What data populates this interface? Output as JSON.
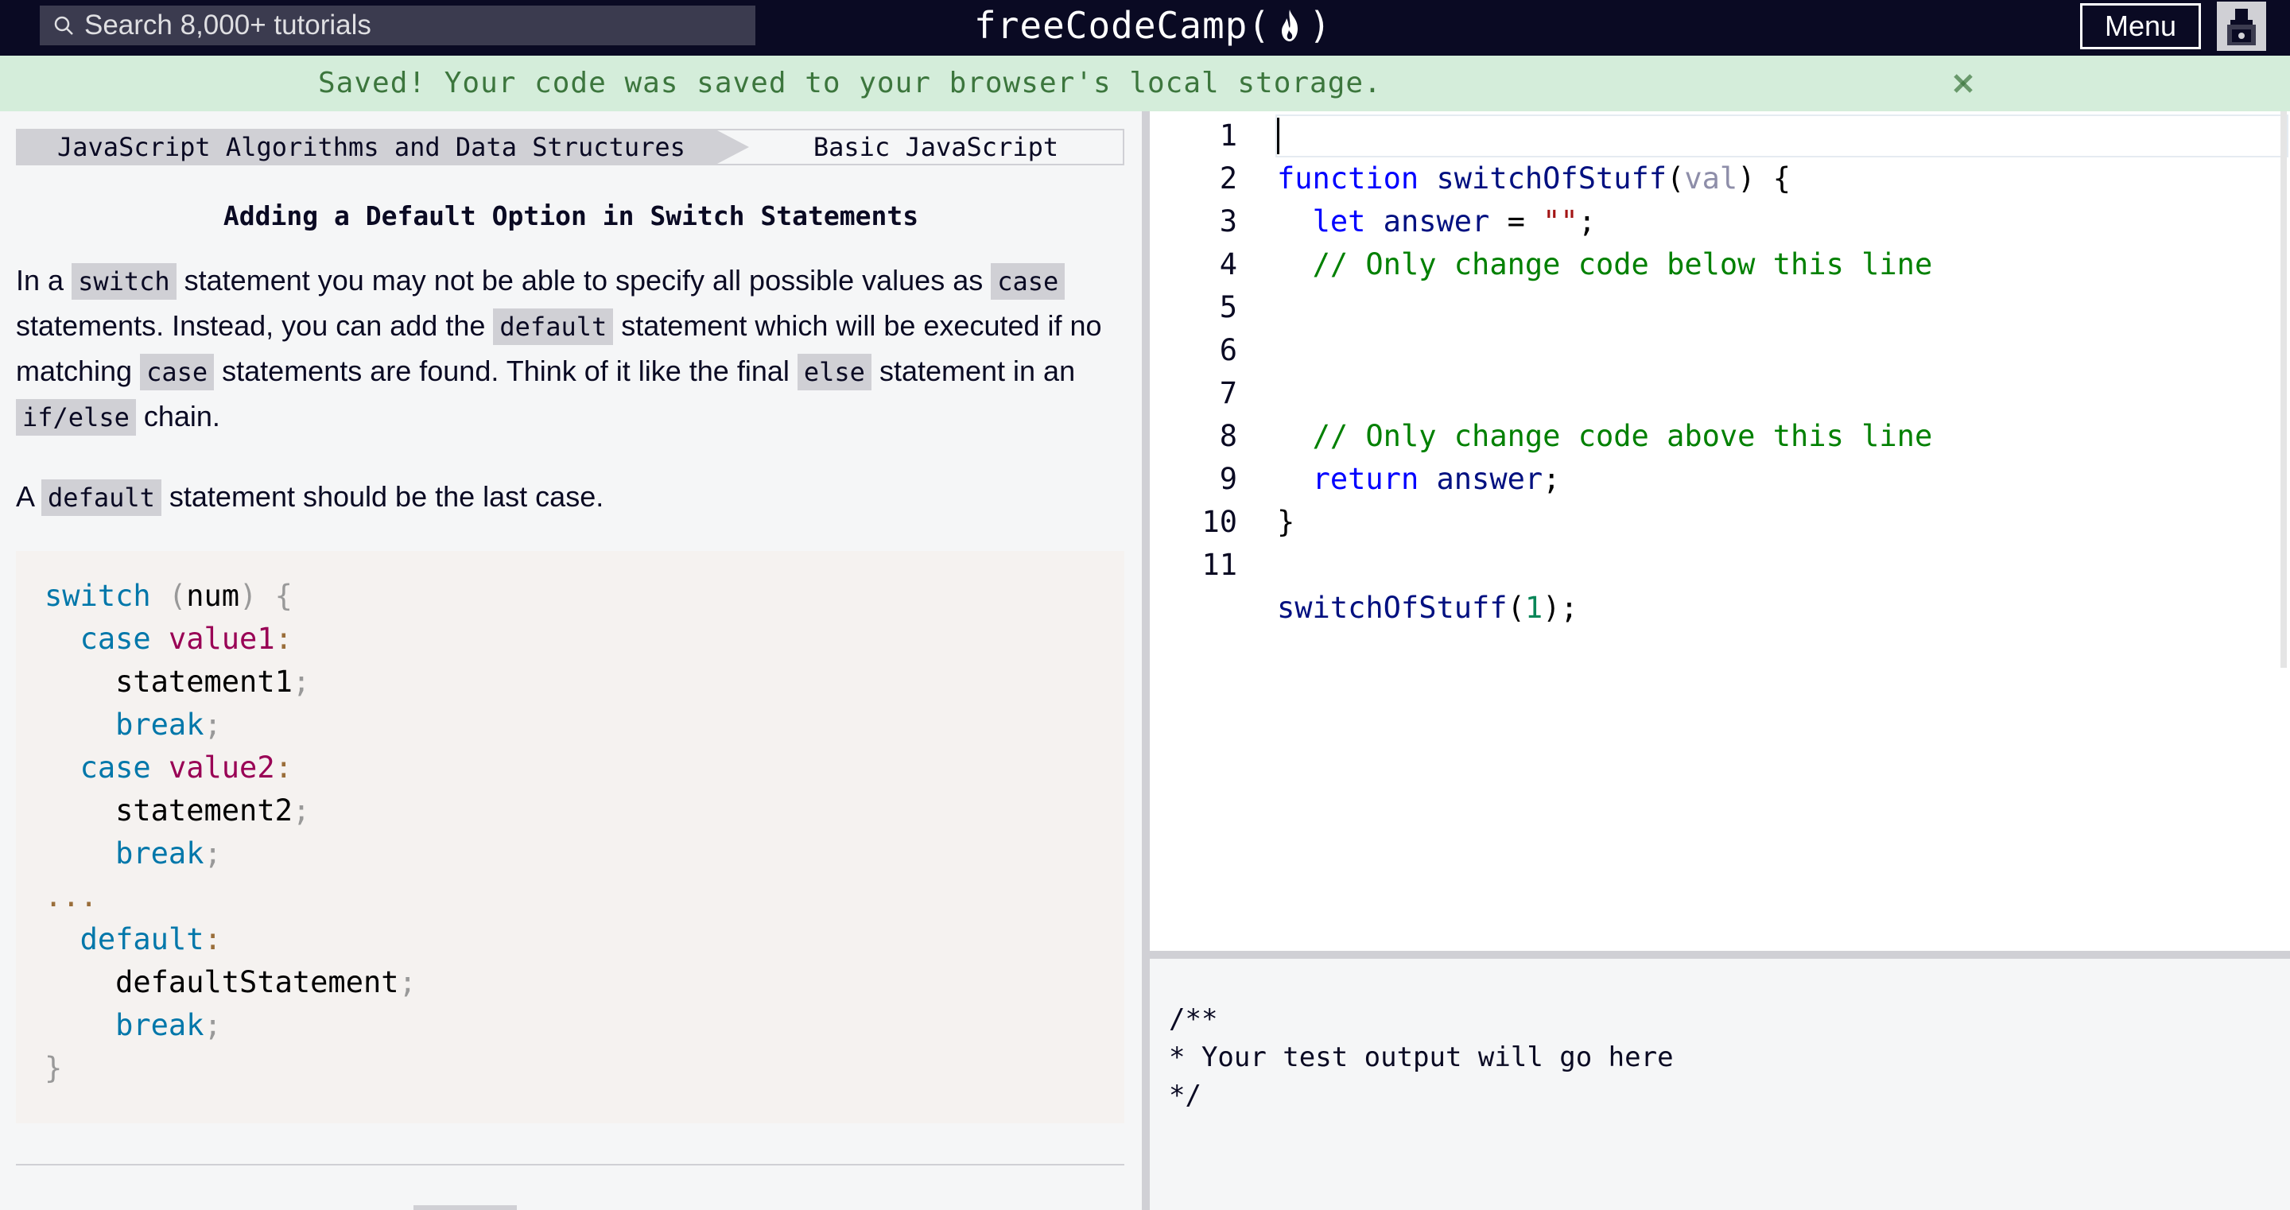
{
  "navbar": {
    "search_placeholder": "Search 8,000+ tutorials",
    "logo_left": "freeCodeCamp(",
    "logo_right": ")",
    "menu_label": "Menu",
    "icons": {
      "search": "search-icon",
      "flame": "flame-icon",
      "avatar": "avatar-icon"
    }
  },
  "flash": {
    "message": "Saved! Your code was saved to your browser's local storage.",
    "close_icon": "close-icon"
  },
  "breadcrumb": {
    "superblock": "JavaScript Algorithms and Data Structures",
    "block": "Basic JavaScript"
  },
  "challenge": {
    "title": "Adding a Default Option in Switch Statements",
    "p1": {
      "t1": "In a ",
      "c1": "switch",
      "t2": " statement you may not be able to specify all possible values as ",
      "c2": "case",
      "t3": " statements. Instead, you can add the ",
      "c3": "default",
      "t4": " statement which will be executed if no matching ",
      "c4": "case",
      "t5": " statements are found. Think of it like the final ",
      "c5": "else",
      "t6": " statement in an ",
      "c6": "if/else",
      "t7": " chain."
    },
    "p2": {
      "t1": "A ",
      "c1": "default",
      "t2": " statement should be the last case."
    },
    "example": {
      "switch_kw": "switch",
      "num": "num",
      "case_kw": "case",
      "value1": "value1",
      "value2": "value2",
      "statement1": "statement1",
      "statement2": "statement2",
      "break_kw": "break",
      "ellipsis": "...",
      "default_kw": "default",
      "default_statement": "defaultStatement"
    }
  },
  "editor": {
    "line_numbers": [
      "1",
      "2",
      "3",
      "4",
      "5",
      "6",
      "7",
      "8",
      "9",
      "10",
      "11"
    ],
    "l1": {
      "kw": "function",
      "name": "switchOfStuff",
      "param": "val"
    },
    "l2": {
      "kw": "let",
      "var": "answer",
      "str": "\"\""
    },
    "l3": {
      "comment": "// Only change code below this line"
    },
    "l7": {
      "comment": "// Only change code above this line"
    },
    "l8": {
      "kw": "return",
      "var": "answer"
    },
    "l11": {
      "call": "switchOfStuff",
      "arg": "1"
    }
  },
  "output": {
    "text": "/**\n* Your test output will go here\n*/"
  }
}
